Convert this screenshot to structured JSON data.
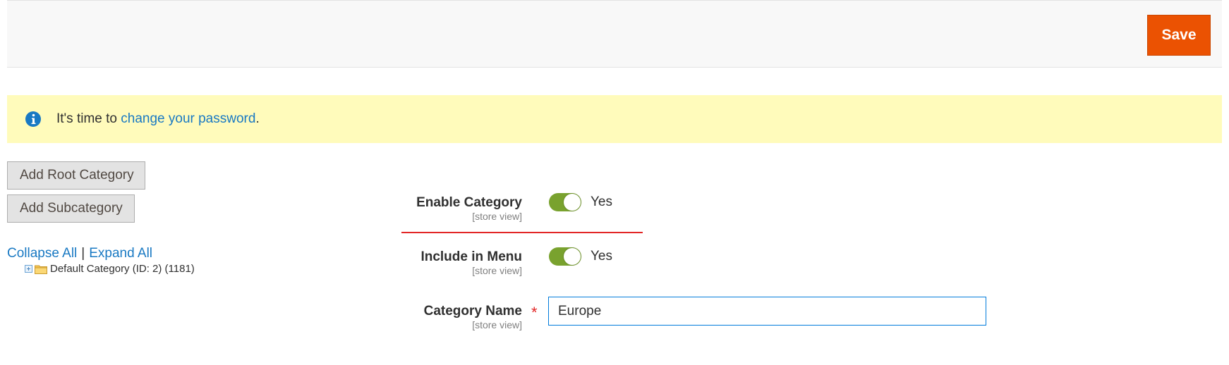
{
  "header": {
    "save_label": "Save"
  },
  "notice": {
    "text_prefix": "It's time to ",
    "link_text": "change your password",
    "text_suffix": "."
  },
  "sidebar": {
    "add_root_label": "Add Root Category",
    "add_sub_label": "Add Subcategory",
    "collapse_all": "Collapse All",
    "separator": "|",
    "expand_all": "Expand All",
    "tree_node_label": "Default Category (ID: 2) (1181)"
  },
  "form": {
    "enable_category": {
      "label": "Enable Category",
      "scope": "[store view]",
      "value_text": "Yes",
      "checked": true
    },
    "include_in_menu": {
      "label": "Include in Menu",
      "scope": "[store view]",
      "value_text": "Yes",
      "checked": true
    },
    "category_name": {
      "label": "Category Name",
      "scope": "[store view]",
      "required_mark": "*",
      "value": "Europe"
    }
  },
  "colors": {
    "accent": "#eb5202",
    "link": "#1979c3",
    "toggle_on": "#79a22e",
    "notice_bg": "#fffbbb",
    "required": "#e22626"
  },
  "icons": {
    "notice": "info-icon",
    "tree_expand": "plus-icon",
    "tree_folder": "folder-icon"
  }
}
